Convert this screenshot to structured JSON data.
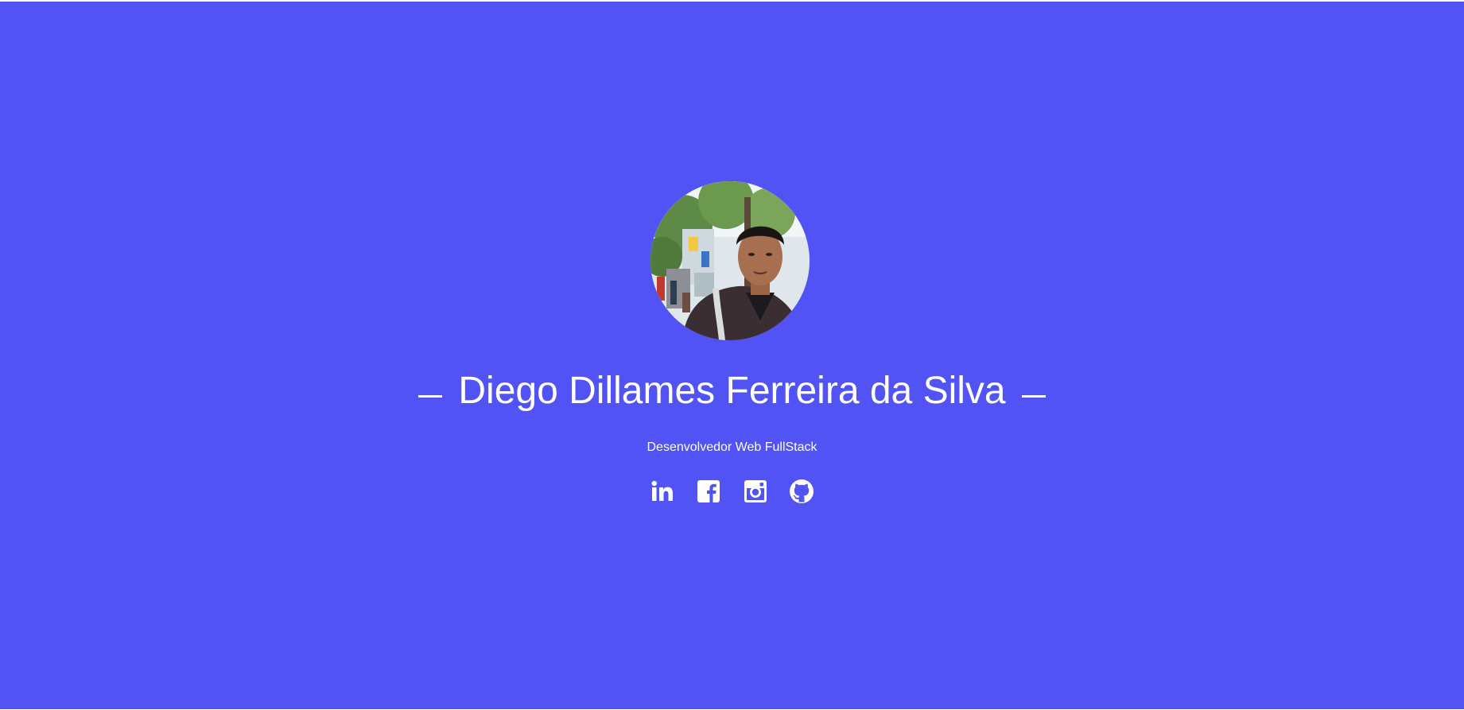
{
  "profile": {
    "name": "Diego Dillames Ferreira da Silva",
    "role": "Desenvolvedor Web FullStack",
    "photo_alt": "Foto de perfil"
  },
  "theme": {
    "background": "#5153f5",
    "text": "#ffffff"
  },
  "socials": [
    {
      "icon": "linkedin-icon"
    },
    {
      "icon": "facebook-icon"
    },
    {
      "icon": "instagram-icon"
    },
    {
      "icon": "github-icon"
    }
  ]
}
